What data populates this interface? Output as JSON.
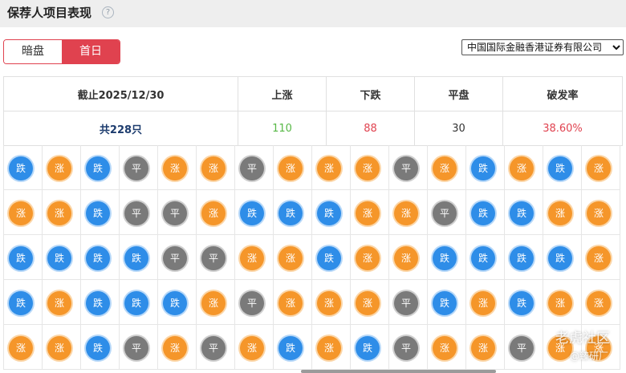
{
  "header": {
    "title": "保荐人项目表现",
    "help_icon": "?"
  },
  "toggle": {
    "left_label": "暗盘",
    "right_label": "首日",
    "active": "首日"
  },
  "broker_select": {
    "value": "中国国际金融香港证券有限公司"
  },
  "summary": {
    "headers": [
      "截止2025/12/30",
      "上涨",
      "下跌",
      "平盘",
      "破发率"
    ],
    "values": {
      "total": "共228只",
      "up": "110",
      "down": "88",
      "flat": "30",
      "rate": "38.60%"
    }
  },
  "legend_labels": {
    "zhang": "涨",
    "die": "跌",
    "ping": "平"
  },
  "grid": [
    [
      "跌",
      "涨",
      "跌",
      "平",
      "涨",
      "涨",
      "平",
      "涨",
      "涨",
      "涨",
      "平",
      "涨",
      "跌",
      "涨",
      "跌",
      "涨"
    ],
    [
      "涨",
      "涨",
      "跌",
      "平",
      "平",
      "涨",
      "跌",
      "跌",
      "跌",
      "涨",
      "涨",
      "平",
      "跌",
      "跌",
      "涨",
      "涨"
    ],
    [
      "跌",
      "跌",
      "跌",
      "跌",
      "平",
      "平",
      "涨",
      "涨",
      "跌",
      "涨",
      "涨",
      "跌",
      "跌",
      "跌",
      "跌",
      "涨"
    ],
    [
      "跌",
      "涨",
      "跌",
      "跌",
      "跌",
      "涨",
      "平",
      "涨",
      "涨",
      "涨",
      "平",
      "跌",
      "涨",
      "跌",
      "涨",
      "涨"
    ],
    [
      "涨",
      "涨",
      "跌",
      "平",
      "涨",
      "平",
      "涨",
      "跌",
      "涨",
      "跌",
      "平",
      "涨",
      "涨",
      "平",
      "涨",
      "涨"
    ]
  ],
  "colors": {
    "zhang": "#f5962a",
    "die": "#2e8de8",
    "ping": "#7a7a7a",
    "accent": "#e0424f",
    "up_text": "#57b846"
  },
  "watermark": {
    "line1": "老虎社区",
    "line2": "@臻研厂"
  }
}
